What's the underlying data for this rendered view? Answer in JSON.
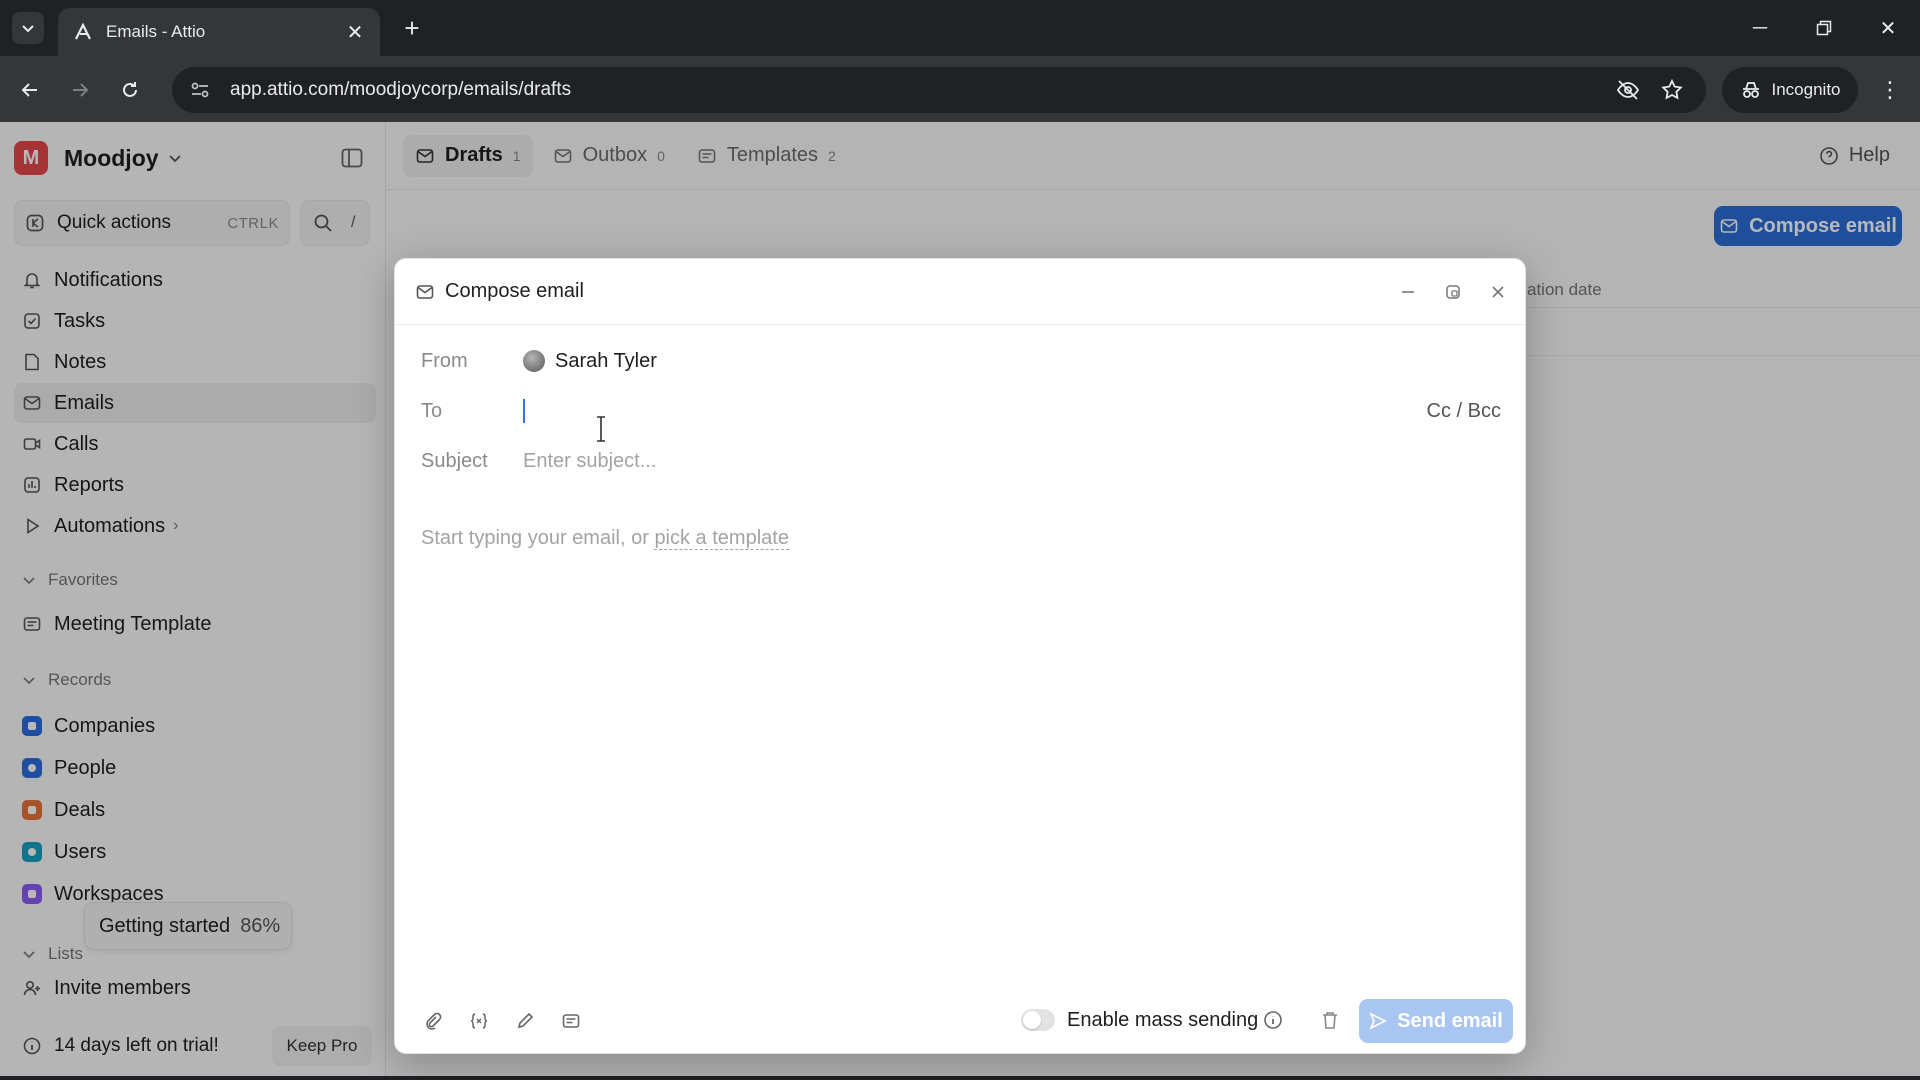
{
  "browser": {
    "tab_title": "Emails - Attio",
    "url": "app.attio.com/moodjoycorp/emails/drafts",
    "incognito_label": "Incognito"
  },
  "sidebar": {
    "workspace_name": "Moodjoy",
    "workspace_initial": "M",
    "quick_actions": {
      "label": "Quick actions",
      "shortcut": "CTRLK",
      "search_shortcut": "/"
    },
    "nav": [
      {
        "label": "Notifications",
        "icon": "bell-icon"
      },
      {
        "label": "Tasks",
        "icon": "checkbox-icon"
      },
      {
        "label": "Notes",
        "icon": "note-icon"
      },
      {
        "label": "Emails",
        "icon": "mail-icon",
        "active": true
      },
      {
        "label": "Calls",
        "icon": "video-icon"
      },
      {
        "label": "Reports",
        "icon": "chart-icon"
      },
      {
        "label": "Automations",
        "icon": "play-icon"
      }
    ],
    "favorites_label": "Favorites",
    "favorites": [
      {
        "label": "Meeting Template",
        "icon": "template-icon"
      }
    ],
    "records_label": "Records",
    "records": [
      {
        "label": "Companies",
        "color": "#2d6ee0"
      },
      {
        "label": "People",
        "color": "#2d6ee0"
      },
      {
        "label": "Deals",
        "color": "#e8743b"
      },
      {
        "label": "Users",
        "color": "#19a0c2"
      },
      {
        "label": "Workspaces",
        "color": "#8b5cf6"
      }
    ],
    "lists_label": "Lists",
    "getting_started": {
      "label": "Getting started",
      "percent": "86%"
    },
    "invite_label": "Invite members",
    "trial_label": "14 days left on trial!",
    "keep_pro_label": "Keep Pro"
  },
  "main": {
    "tabs": [
      {
        "label": "Drafts",
        "count": "1",
        "active": true
      },
      {
        "label": "Outbox",
        "count": "0"
      },
      {
        "label": "Templates",
        "count": "2"
      }
    ],
    "help_label": "Help",
    "compose_label": "Compose email",
    "column_partial": "ation date"
  },
  "compose": {
    "title": "Compose email",
    "from_label": "From",
    "from_name": "Sarah Tyler",
    "to_label": "To",
    "cc_bcc_label": "Cc / Bcc",
    "subject_label": "Subject",
    "subject_placeholder": "Enter subject...",
    "body_placeholder_prefix": "Start typing your email, or ",
    "body_placeholder_link": "pick a template",
    "mass_sending_label": "Enable mass sending",
    "mass_sending_enabled": false,
    "send_label": "Send email"
  }
}
